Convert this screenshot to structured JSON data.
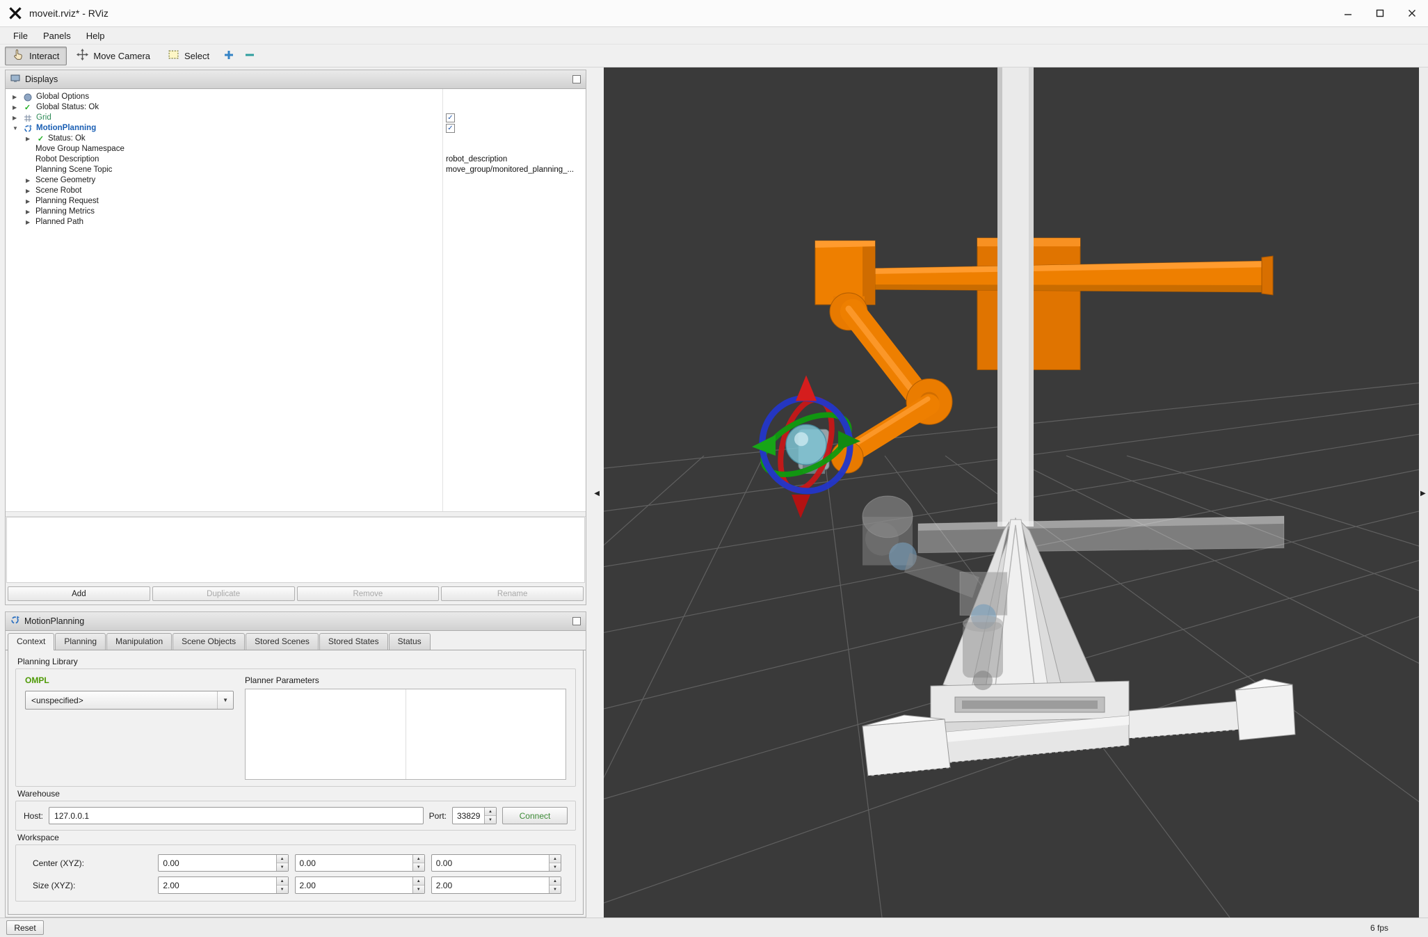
{
  "window": {
    "title": "moveit.rviz* - RViz"
  },
  "menu": {
    "items": [
      "File",
      "Panels",
      "Help"
    ]
  },
  "toolbar": {
    "interact": "Interact",
    "move_camera": "Move Camera",
    "select": "Select"
  },
  "displays": {
    "title": "Displays",
    "tree": [
      {
        "label": "Global Options"
      },
      {
        "label": "Global Status: Ok"
      },
      {
        "label": "Grid",
        "checked": true
      },
      {
        "label": "MotionPlanning",
        "checked": true
      },
      {
        "label": "Status: Ok"
      },
      {
        "label": "Move Group Namespace"
      },
      {
        "label": "Robot Description",
        "value": "robot_description"
      },
      {
        "label": "Planning Scene Topic",
        "value": "move_group/monitored_planning_..."
      },
      {
        "label": "Scene Geometry"
      },
      {
        "label": "Scene Robot"
      },
      {
        "label": "Planning Request"
      },
      {
        "label": "Planning Metrics"
      },
      {
        "label": "Planned Path"
      }
    ],
    "buttons": {
      "add": "Add",
      "duplicate": "Duplicate",
      "remove": "Remove",
      "rename": "Rename"
    }
  },
  "motion_panel": {
    "title": "MotionPlanning",
    "tabs": [
      "Context",
      "Planning",
      "Manipulation",
      "Scene Objects",
      "Stored Scenes",
      "Stored States",
      "Status"
    ],
    "active_tab": "Context",
    "context": {
      "planning_library": "Planning Library",
      "library_name": "OMPL",
      "planner_value": "<unspecified>",
      "planner_parameters": "Planner Parameters",
      "warehouse": "Warehouse",
      "host_label": "Host:",
      "host": "127.0.0.1",
      "port_label": "Port:",
      "port": "33829",
      "connect": "Connect",
      "workspace": "Workspace",
      "center_label": "Center (XYZ):",
      "center": [
        "0.00",
        "0.00",
        "0.00"
      ],
      "size_label": "Size (XYZ):",
      "size": [
        "2.00",
        "2.00",
        "2.00"
      ]
    }
  },
  "statusbar": {
    "reset": "Reset",
    "fps": "6 fps"
  },
  "colors": {
    "grid_label": "#2e8b57",
    "motionplanning_label": "#1a5fb4",
    "ompl_green": "#4e9a06",
    "connect_green": "#3d8b37",
    "robot_orange": "#ee7f00",
    "viewport_background": "#3a3a3a"
  }
}
